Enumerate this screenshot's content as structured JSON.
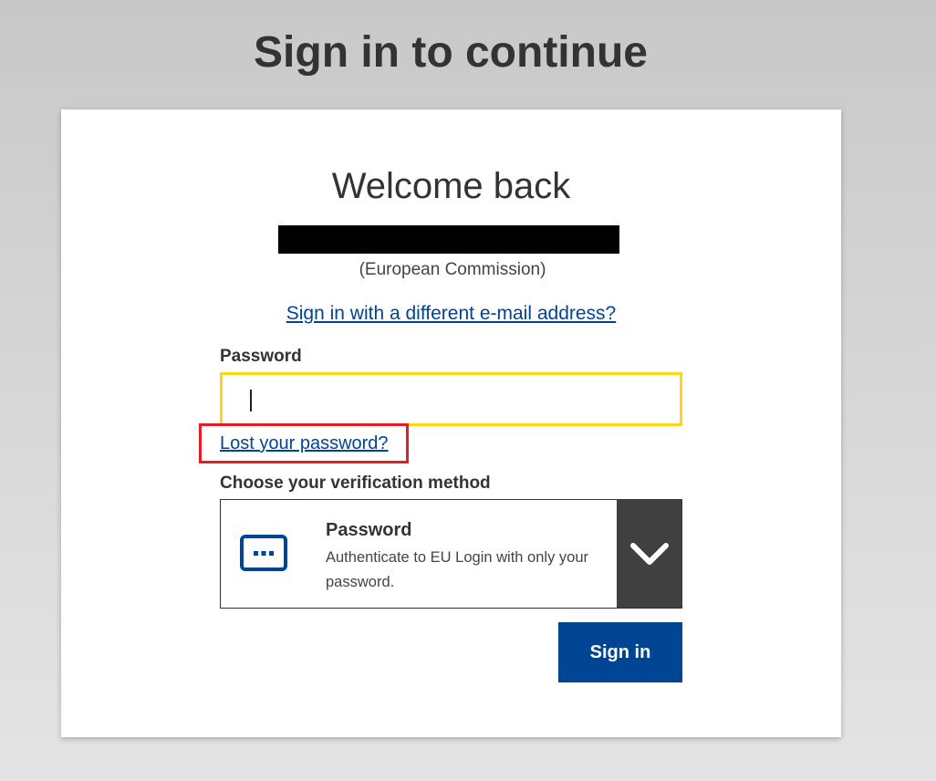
{
  "page": {
    "title": "Sign in to continue"
  },
  "card": {
    "welcome": "Welcome back",
    "organization": "(European Commission)",
    "different_email_link": "Sign in with a different e-mail address?",
    "password_label": "Password",
    "password_value": "",
    "lost_password_link": "Lost your password?",
    "verification_label": "Choose your verification method",
    "method": {
      "title": "Password",
      "description": "Authenticate to EU Login with only your password.",
      "icon": "password-dots-icon"
    },
    "signin_button": "Sign in"
  },
  "colors": {
    "link": "#004494",
    "primary_button": "#004494",
    "focus_border": "#ffd617",
    "highlight_box": "#e31e24",
    "chevron_bg": "#404040"
  }
}
